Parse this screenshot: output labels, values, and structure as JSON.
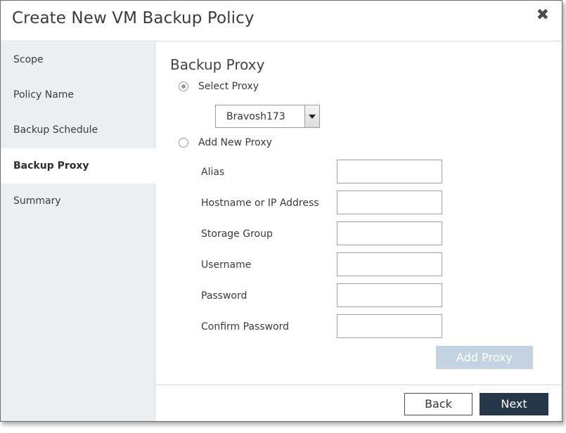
{
  "dialog": {
    "title": "Create New VM Backup Policy",
    "close_icon": "close-icon"
  },
  "sidebar": {
    "items": [
      {
        "label": "Scope",
        "active": false
      },
      {
        "label": "Policy Name",
        "active": false
      },
      {
        "label": "Backup Schedule",
        "active": false
      },
      {
        "label": "Backup Proxy",
        "active": true
      },
      {
        "label": "Summary",
        "active": false
      }
    ]
  },
  "main": {
    "section_title": "Backup Proxy",
    "select_proxy_label": "Select Proxy",
    "select_proxy_checked": true,
    "proxy_dropdown_value": "Bravosh173",
    "add_new_proxy_label": "Add New Proxy",
    "add_new_proxy_checked": false,
    "fields": [
      {
        "label": "Alias",
        "value": ""
      },
      {
        "label": "Hostname or IP Address",
        "value": ""
      },
      {
        "label": "Storage Group",
        "value": ""
      },
      {
        "label": "Username",
        "value": ""
      },
      {
        "label": "Password",
        "value": ""
      },
      {
        "label": "Confirm Password",
        "value": ""
      }
    ],
    "add_proxy_label": "Add Proxy"
  },
  "footer": {
    "back_label": "Back",
    "next_label": "Next"
  },
  "colors": {
    "sidebar_bg": "#eceff1",
    "next_button_bg": "#26374a",
    "add_proxy_disabled_bg": "#c3d3e1"
  }
}
